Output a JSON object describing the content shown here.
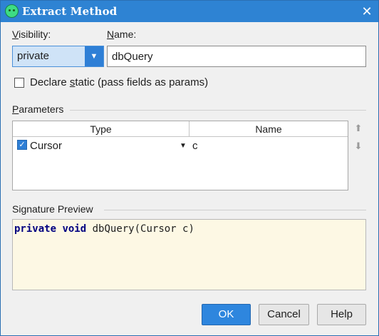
{
  "window": {
    "title": "Extract Method",
    "close_glyph": "✕",
    "app_icon": "android-icon"
  },
  "form": {
    "visibility_label_first": "V",
    "visibility_label_rest": "isibility:",
    "visibility_value": "private",
    "name_label_first": "N",
    "name_label_rest": "ame:",
    "name_value": "dbQuery",
    "declare_static_pre": "Declare ",
    "declare_static_u": "s",
    "declare_static_post": "tatic (pass fields as params)",
    "declare_static_checked": false
  },
  "parameters": {
    "section_label_first": "P",
    "section_label_rest": "arameters",
    "columns": [
      "Type",
      "Name"
    ],
    "rows": [
      {
        "checked": true,
        "type": "Cursor",
        "name": "c"
      }
    ],
    "move_up_glyph": "⬆",
    "move_down_glyph": "⬇"
  },
  "signature": {
    "section_label": "Signature Preview",
    "kw1": "private",
    "kw2": "void",
    "rest": " dbQuery(Cursor c)"
  },
  "buttons": {
    "ok": "OK",
    "cancel": "Cancel",
    "help": "Help"
  }
}
